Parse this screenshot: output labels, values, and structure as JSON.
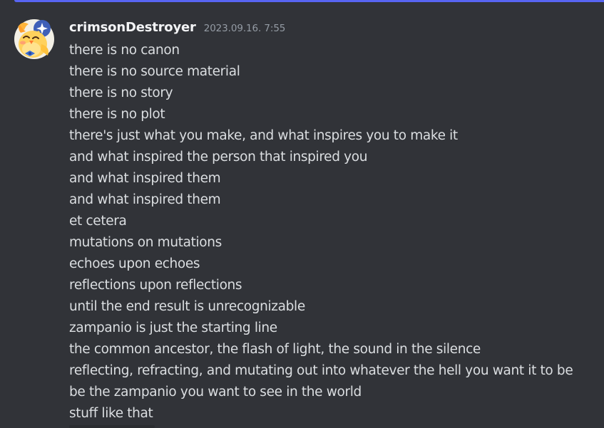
{
  "message": {
    "author": "crimsonDestroyer",
    "timestamp": "2023.09.16. 7:55",
    "avatar_icon": "chick-with-stars-avatar-icon",
    "lines": [
      "there is no canon",
      "there is no source material",
      "there is no story",
      "there is no plot",
      "there's just what you make, and what inspires you to make it",
      "and what inspired the person that inspired you",
      "and what inspired them",
      "and what inspired them",
      "et cetera",
      "mutations on mutations",
      "echoes upon echoes",
      "reflections upon reflections",
      "until the end result is unrecognizable",
      "zampanio is just the starting line",
      "the common ancestor, the flash of light, the sound in the silence",
      "reflecting, refracting, and mutating out into whatever the hell you want it to be",
      "be the zampanio you want to see in the world",
      "stuff like that"
    ]
  },
  "colors": {
    "background": "#313338",
    "username": "#f2f3f5",
    "text": "#dbdee1",
    "timestamp": "#949ba4",
    "accent": "#5865f2"
  }
}
